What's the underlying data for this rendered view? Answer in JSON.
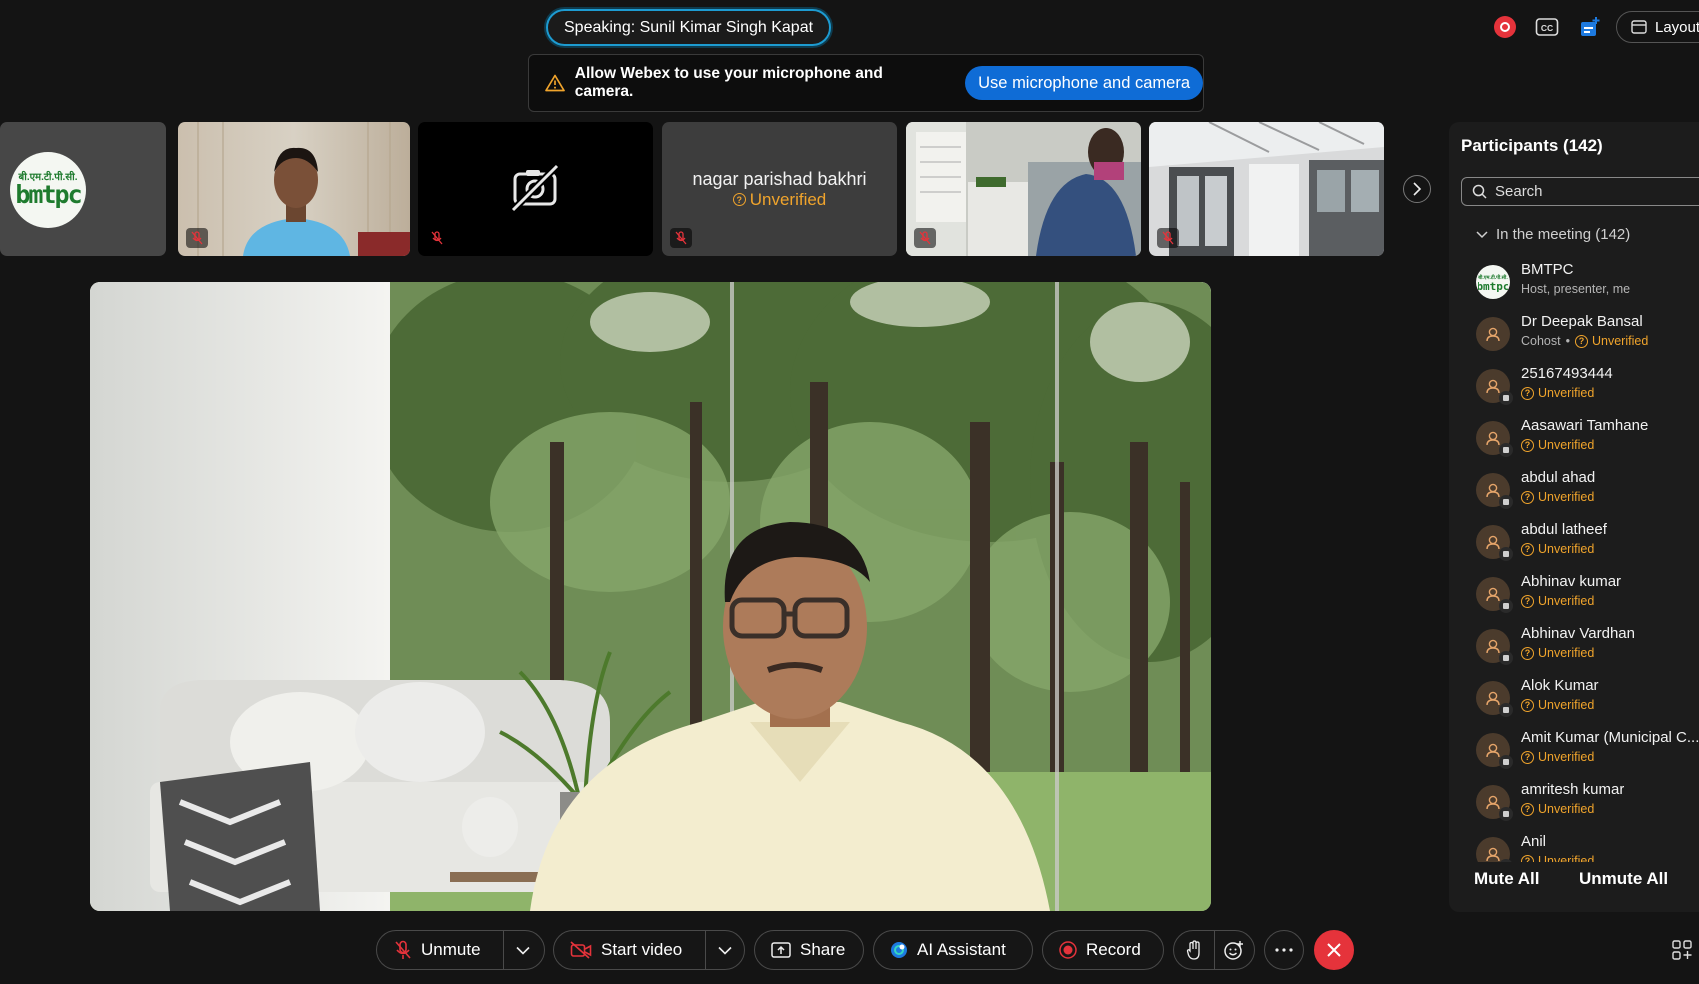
{
  "speaking": "Speaking: Sunil Kimar Singh Kapat",
  "top_bar": {
    "layout_label": "Layout"
  },
  "banner": {
    "message": "Allow Webex to use your microphone and camera.",
    "button": "Use microphone and camera"
  },
  "filmstrip": {
    "logo_text": "बी.एम.टी.पी.सी.",
    "logo_brand": "bmtpc",
    "audio_only_name": "nagar parishad bakhri",
    "audio_only_status": "Unverified"
  },
  "participants": {
    "title": "Participants (142)",
    "search_placeholder": "Search",
    "section": "In the meeting (142)",
    "list": [
      {
        "name": "BMTPC",
        "sub": "Host, presenter, me"
      },
      {
        "name": "Dr Deepak Bansal",
        "role": "Cohost",
        "status": "Unverified"
      },
      {
        "name": "25167493444",
        "status": "Unverified"
      },
      {
        "name": "Aasawari Tamhane",
        "status": "Unverified"
      },
      {
        "name": "abdul ahad",
        "status": "Unverified"
      },
      {
        "name": "abdul latheef",
        "status": "Unverified"
      },
      {
        "name": "Abhinav kumar",
        "status": "Unverified"
      },
      {
        "name": "Abhinav Vardhan",
        "status": "Unverified"
      },
      {
        "name": "Alok Kumar",
        "status": "Unverified"
      },
      {
        "name": "Amit Kumar (Municipal C...",
        "status": "Unverified"
      },
      {
        "name": "amritesh kumar",
        "status": "Unverified"
      },
      {
        "name": "Anil",
        "status": "Unverified"
      }
    ],
    "mute_all": "Mute All",
    "unmute_all": "Unmute All"
  },
  "toolbar": {
    "unmute": "Unmute",
    "start_video": "Start video",
    "share": "Share",
    "ai_assistant": "AI Assistant",
    "record": "Record"
  },
  "colors": {
    "accent": "#0f6cd6",
    "warning": "#f0a42c",
    "end_call": "#e5333b",
    "speaking_border": "#1d9bd1"
  }
}
